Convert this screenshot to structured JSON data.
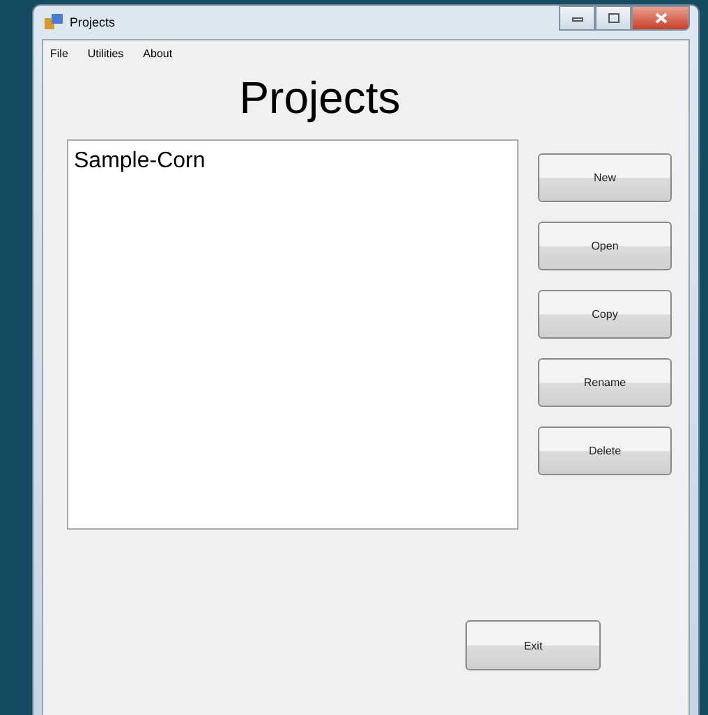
{
  "window": {
    "title": "Projects"
  },
  "menu": [
    {
      "label": "File"
    },
    {
      "label": "Utilities"
    },
    {
      "label": "About"
    }
  ],
  "heading": "Projects",
  "projects": [
    {
      "name": "Sample-Corn",
      "selected": false
    }
  ],
  "buttons": [
    "New",
    "Open",
    "Copy",
    "Rename",
    "Delete"
  ],
  "exit_button": "Exit"
}
